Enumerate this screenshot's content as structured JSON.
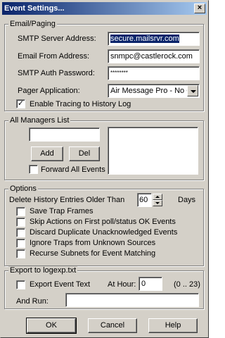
{
  "window": {
    "title": "Event Settings...",
    "close_glyph": "×"
  },
  "email_paging": {
    "legend": "Email/Paging",
    "smtp_server_label": "SMTP Server Address:",
    "smtp_server_value": "secure.mailsrvr.com",
    "email_from_label": "Email From Address:",
    "email_from_value": "snmpc@castlerock.com",
    "smtp_auth_label": "SMTP Auth Password:",
    "smtp_auth_value": "********",
    "pager_app_label": "Pager Application:",
    "pager_app_value": "Air Message Pro - No Q",
    "tracing_label": "Enable Tracing to History Log",
    "tracing_checked": true
  },
  "managers": {
    "legend": "All Managers List",
    "input_value": "",
    "add_label": "Add",
    "del_label": "Del",
    "forward_label": "Forward All Events",
    "forward_checked": false
  },
  "options": {
    "legend": "Options",
    "delete_history_label": "Delete History Entries Older Than",
    "delete_history_value": "60",
    "days_label": "Days",
    "checks": [
      {
        "label": "Save Trap Frames",
        "checked": false
      },
      {
        "label": "Skip Actions on First poll/status OK Events",
        "checked": false
      },
      {
        "label": "Discard Duplicate Unacknowledged Events",
        "checked": false
      },
      {
        "label": "Ignore Traps from Unknown Sources",
        "checked": false
      },
      {
        "label": "Recurse Subnets for Event Matching",
        "checked": false
      }
    ]
  },
  "export": {
    "legend": "Export to logexp.txt",
    "export_text_label": "Export Event Text",
    "export_checked": false,
    "at_hour_label": "At Hour:",
    "at_hour_value": "0",
    "range_label": "(0 .. 23)",
    "and_run_label": "And Run:",
    "and_run_value": ""
  },
  "buttons": {
    "ok": "OK",
    "cancel": "Cancel",
    "help": "Help"
  },
  "check_glyph": "✓"
}
